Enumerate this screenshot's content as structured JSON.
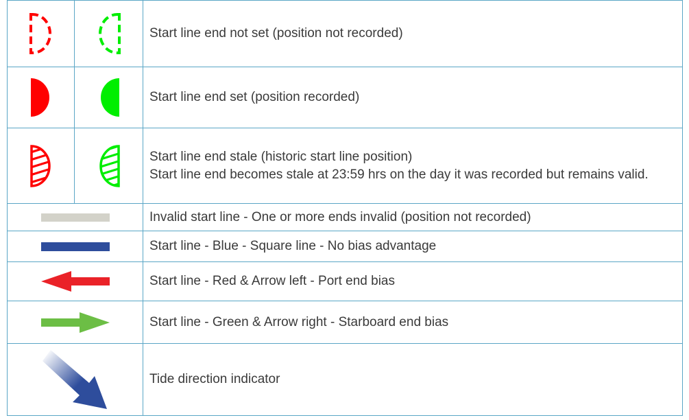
{
  "colors": {
    "red": "#ff0000",
    "green": "#00ee00",
    "invalid_gray": "#d3d2c9",
    "blue": "#2e4d9c",
    "arrow_red": "#ea2228",
    "arrow_green": "#6cbe45",
    "table_border": "#5aa6c6"
  },
  "rows": [
    {
      "icons": [
        "red-dashed-half-circle-icon",
        "green-dashed-half-circle-icon"
      ],
      "description": "Start line end not set (position not recorded)"
    },
    {
      "icons": [
        "red-filled-half-circle-icon",
        "green-filled-half-circle-icon"
      ],
      "description": "Start line end set (position recorded)"
    },
    {
      "icons": [
        "red-hatched-half-circle-icon",
        "green-hatched-half-circle-icon"
      ],
      "description_line1": "Start line end stale (historic start line position)",
      "description_line2": "Start line end becomes stale at 23:59 hrs on the day it was recorded but remains valid."
    },
    {
      "icon": "gray-line-icon",
      "description": "Invalid start line - One or more ends invalid (position not recorded)"
    },
    {
      "icon": "blue-line-icon",
      "description": "Start line - Blue - Square line - No bias advantage"
    },
    {
      "icon": "red-arrow-left-icon",
      "description": "Start line - Red & Arrow left - Port end bias"
    },
    {
      "icon": "green-arrow-right-icon",
      "description": "Start line - Green & Arrow right - Starboard end bias"
    },
    {
      "icon": "tide-direction-arrow-icon",
      "description": "Tide direction indicator"
    }
  ]
}
